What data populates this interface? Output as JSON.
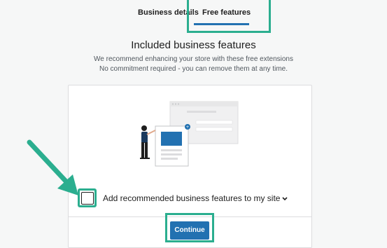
{
  "tabs": [
    {
      "label": "Business details",
      "active": false
    },
    {
      "label": "Free features",
      "active": true
    }
  ],
  "heading": "Included business features",
  "subtitle_lines": [
    "We recommend enhancing your store with these free extensions",
    "No commitment required - you can remove them at any time."
  ],
  "feature_option": {
    "label": "Add recommended business features to my site",
    "checked": false
  },
  "continue_label": "Continue",
  "colors": {
    "accent": "#2271b1",
    "annotation": "#2bae8f",
    "background": "#f6f7f7"
  },
  "icons": [
    "chevron-down-icon",
    "annotation-arrow-icon",
    "illustration-person-icon"
  ]
}
